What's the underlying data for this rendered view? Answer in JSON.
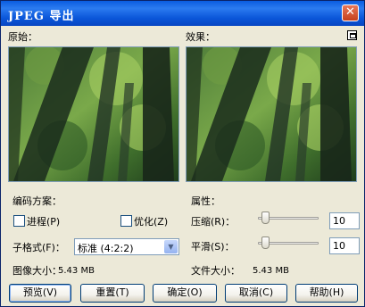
{
  "window": {
    "title": "JPEG 导出",
    "close_glyph": "✕"
  },
  "preview": {
    "original_label": "原始：",
    "effect_label": "效果："
  },
  "encoding": {
    "section_label": "编码方案：",
    "progressive_label": "进程(P)",
    "progressive_checked": false,
    "optimize_label": "优化(Z)",
    "optimize_checked": false,
    "subformat_label": "子格式(F)：",
    "subformat_value": "标准 (4:2:2)",
    "image_size_label": "图像大小：",
    "image_size_value": "5.43 MB"
  },
  "properties": {
    "section_label": "属性：",
    "compression_label": "压缩(R)：",
    "compression_value": "10",
    "smoothing_label": "平滑(S)：",
    "smoothing_value": "10",
    "file_size_label": "文件大小：",
    "file_size_value": "5.43 MB"
  },
  "buttons": {
    "preview": "预览(V)",
    "reset": "重置(T)",
    "ok": "确定(O)",
    "cancel": "取消(C)",
    "help": "帮助(H)"
  },
  "icons": {
    "close": "close-icon",
    "preview_toggle": "split-view-icon",
    "dropdown": "chevron-down-icon"
  },
  "colors": {
    "titlebar": "#0a5ce0",
    "dialog_bg": "#ece9d8",
    "button_border": "#003c74"
  }
}
